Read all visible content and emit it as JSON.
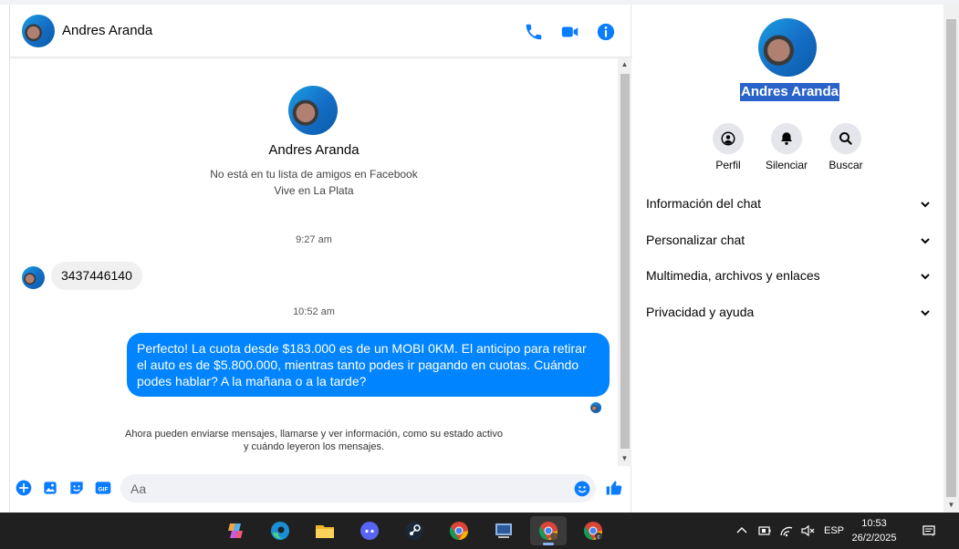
{
  "chat": {
    "contact_name": "Andres Aranda",
    "intro": {
      "name": "Andres Aranda",
      "line1": "No está en tu lista de amigos en Facebook",
      "line2": "Vive en La Plata"
    },
    "messages": [
      {
        "time": "9:27 am",
        "text": "3437446140",
        "direction": "incoming"
      },
      {
        "time": "10:52 am",
        "text": "Perfecto! La cuota desde $183.000 es de un MOBI 0KM. El anticipo para retirar el auto es de $5.800.000, mientras tanto podes ir pagando en cuotas. Cuándo podes hablar? A la mañana o a la tarde?",
        "direction": "outgoing"
      }
    ],
    "footer_note_line1": "Ahora pueden enviarse mensajes, llamarse y ver información, como su estado activo",
    "footer_note_line2": "y cuándo leyeron los mensajes.",
    "composer_placeholder": "Aa"
  },
  "panel": {
    "name": "Andres Aranda",
    "actions": [
      {
        "label": "Perfil",
        "icon": "profile-icon"
      },
      {
        "label": "Silenciar",
        "icon": "bell-icon"
      },
      {
        "label": "Buscar",
        "icon": "search-icon"
      }
    ],
    "sections": [
      "Información del chat",
      "Personalizar chat",
      "Multimedia, archivos y enlaces",
      "Privacidad y ayuda"
    ]
  },
  "taskbar": {
    "language": "ESP",
    "time": "10:53",
    "date": "26/2/2025",
    "apps": [
      "copilot",
      "edge",
      "file-explorer",
      "discord",
      "steam",
      "chrome",
      "control-panel",
      "chrome-profile",
      "chrome-profile-c"
    ]
  },
  "colors": {
    "messenger_blue": "#0084ff",
    "icon_blue": "#0a7cff",
    "selection": "#2962c9"
  }
}
